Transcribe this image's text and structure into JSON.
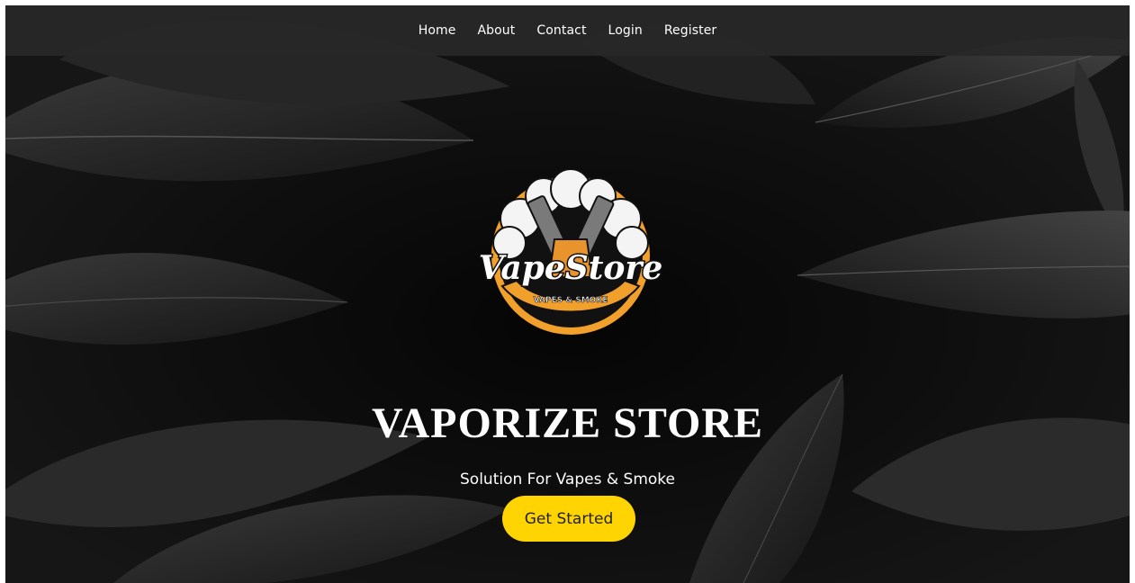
{
  "nav": {
    "items": [
      {
        "label": "Home"
      },
      {
        "label": "About"
      },
      {
        "label": "Contact"
      },
      {
        "label": "Login"
      },
      {
        "label": "Register"
      }
    ]
  },
  "logo": {
    "main_text": "VapeStore",
    "sub_text": "VAPES & SMOKE"
  },
  "hero": {
    "title": "VAPORIZE STORE",
    "subtitle": "Solution For Vapes & Smoke",
    "cta_label": "Get Started"
  },
  "colors": {
    "accent": "#ffd400",
    "nav_bg": "#282828",
    "logo_orange": "#f2a02c",
    "page_bg": "#0c0c0c"
  }
}
